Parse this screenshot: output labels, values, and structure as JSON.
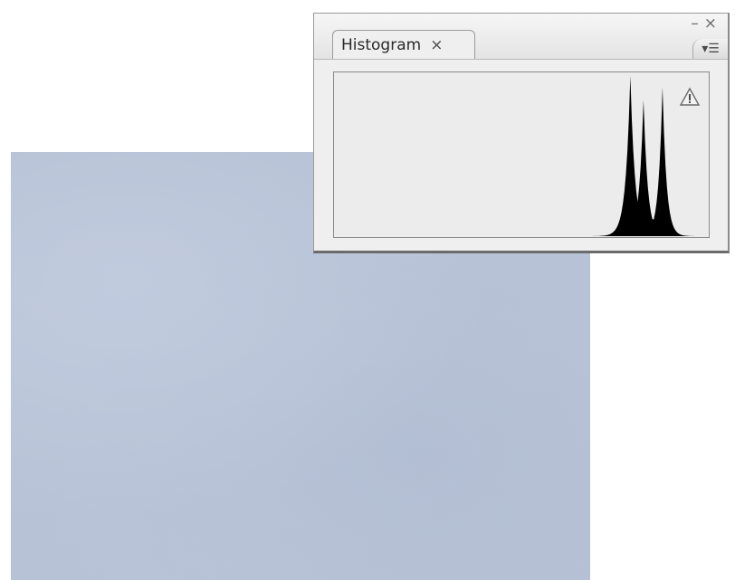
{
  "panel": {
    "tab_label": "Histogram",
    "tab_close_glyph": "×",
    "minimize_glyph": "–",
    "close_glyph": "×",
    "menu_glyph": "▾☰",
    "warning_icon": "warning-triangle-icon"
  },
  "chart_data": {
    "type": "area",
    "x_domain": [
      0,
      255
    ],
    "y_domain": [
      0,
      1
    ],
    "channels": "luminosity",
    "peaks": [
      {
        "center": 202,
        "height": 1.0,
        "width": 3.5
      },
      {
        "center": 211,
        "height": 0.85,
        "width": 3.2
      },
      {
        "center": 224,
        "height": 0.93,
        "width": 3.0
      }
    ],
    "grid": false,
    "fill_color": "#000000"
  },
  "colors": {
    "canvas": "#b8c2d6",
    "panel_bg": "#efefef",
    "histogram_bg": "#ececec"
  }
}
